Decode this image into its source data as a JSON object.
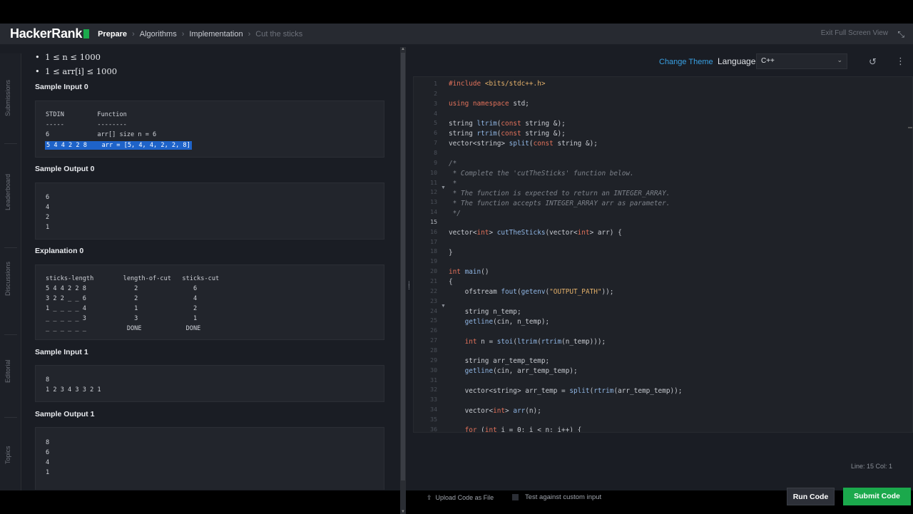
{
  "nav": {
    "logo": "HackerRank",
    "breadcrumbs": [
      "Prepare",
      "Algorithms",
      "Implementation",
      "Cut the sticks"
    ],
    "exit_fullscreen": "Exit Full Screen View"
  },
  "rail": [
    "Submissions",
    "Leaderboard",
    "Discussions",
    "Editorial",
    "Topics"
  ],
  "problem": {
    "constraints": [
      "1 ≤ n ≤ 1000",
      "1 ≤ arr[i] ≤ 1000"
    ],
    "sample_input_0_title": "Sample Input 0",
    "sample_input_0": {
      "header": "STDIN         Function",
      "rule": "-----         --------",
      "line1": "6             arr[] size n = 6",
      "line2": "5 4 4 2 2 8    arr = [5, 4, 4, 2, 2, 8]"
    },
    "sample_output_0_title": "Sample Output 0",
    "sample_output_0": [
      "6",
      "4",
      "2",
      "1"
    ],
    "explanation_0_title": "Explanation 0",
    "explanation_0": [
      "sticks-length        length-of-cut   sticks-cut",
      "5 4 4 2 2 8             2               6",
      "3 2 2 _ _ 6             2               4",
      "1 _ _ _ _ 4             1               2",
      "_ _ _ _ _ 3             3               1",
      "_ _ _ _ _ _           DONE            DONE"
    ],
    "sample_input_1_title": "Sample Input 1",
    "sample_input_1": [
      "8",
      "1 2 3 4 3 3 2 1"
    ],
    "sample_output_1_title": "Sample Output 1",
    "sample_output_1": [
      "8",
      "6",
      "4",
      "1"
    ]
  },
  "editor": {
    "change_theme": "Change Theme",
    "language_label": "Language",
    "language": "C++",
    "status": "Line: 15 Col: 1",
    "line_numbers": [
      "1",
      "2",
      "3",
      "4",
      "5",
      "6",
      "7",
      "8",
      "9",
      "10",
      "11",
      "12",
      "13",
      "14",
      "15",
      "16",
      "17",
      "18",
      "19",
      "20",
      "21",
      "22",
      "23",
      "24",
      "25",
      "26",
      "27",
      "28",
      "29",
      "30",
      "31",
      "32",
      "33",
      "34",
      "35",
      "36"
    ]
  },
  "footer": {
    "upload": "Upload Code as File",
    "custom_input": "Test against custom input",
    "run": "Run Code",
    "submit": "Submit Code"
  },
  "colors": {
    "accent_green": "#1ba94c",
    "link_blue": "#39a1e4",
    "selection_blue": "#1e63c9"
  }
}
